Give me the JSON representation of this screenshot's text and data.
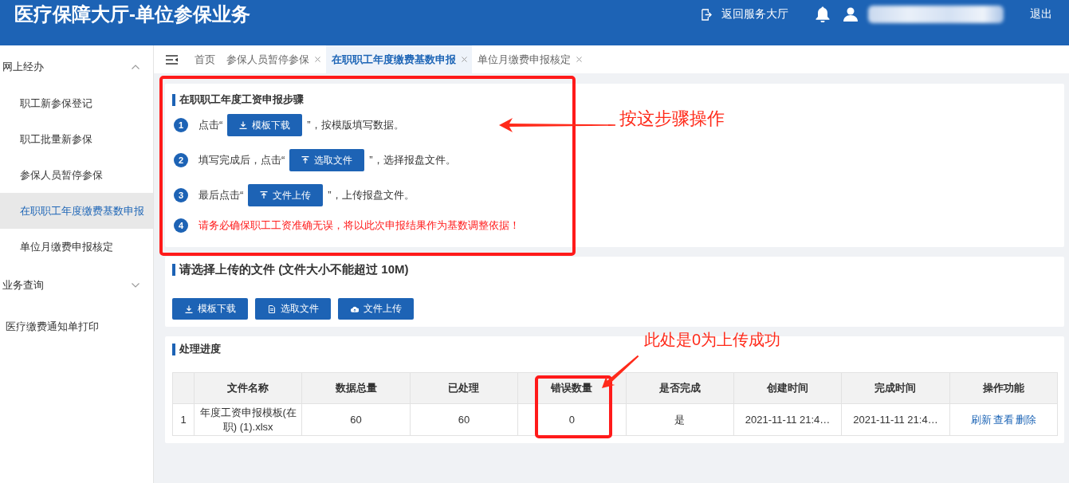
{
  "header": {
    "title": "医疗保障大厅-单位参保业务",
    "back_link": "返回服务大厅",
    "user_name_blurred": true,
    "logout": "退出"
  },
  "sidebar": {
    "items": [
      {
        "kind": "group",
        "label": "网上经办",
        "expanded": true,
        "children": [
          {
            "label": "职工新参保登记",
            "selected": false
          },
          {
            "label": "职工批量新参保",
            "selected": false
          },
          {
            "label": "参保人员暂停参保",
            "selected": false
          },
          {
            "label": "在职职工年度缴费基数申报",
            "selected": true
          },
          {
            "label": "单位月缴费申报核定",
            "selected": false
          }
        ]
      },
      {
        "kind": "group",
        "label": "业务查询",
        "expanded": false
      },
      {
        "kind": "link",
        "label": "医疗缴费通知单打印",
        "selected": false
      }
    ]
  },
  "tabs": [
    {
      "label": "首页",
      "closable": false,
      "selected": false
    },
    {
      "label": "参保人员暂停参保",
      "closable": true,
      "selected": false
    },
    {
      "label": "在职职工年度缴费基数申报",
      "closable": true,
      "selected": true
    },
    {
      "label": "单位月缴费申报核定",
      "closable": true,
      "selected": false
    }
  ],
  "steps_panel": {
    "title": "在职职工年度工资申报步骤",
    "steps": [
      {
        "number": "1",
        "kind": "button",
        "before": "点击“",
        "button": {
          "label": "模板下载",
          "kind": "download"
        },
        "after": "”，按模版填写数据。"
      },
      {
        "number": "2",
        "kind": "button",
        "before": "填写完成后，点击“",
        "button": {
          "label": "选取文件",
          "kind": "upload"
        },
        "after": "”，选择报盘文件。"
      },
      {
        "number": "3",
        "kind": "button",
        "before": "最后点击“",
        "button": {
          "label": "文件上传",
          "kind": "upload"
        },
        "after": "”，上传报盘文件。"
      },
      {
        "number": "4",
        "kind": "notice",
        "text": "请务必确保职工工资准确无误，将以此次申报结果作为基数调整依据！"
      }
    ]
  },
  "upload_panel": {
    "title": "请选择上传的文件 (文件大小不能超过 10M)",
    "buttons": [
      {
        "label": "模板下载",
        "kind": "download"
      },
      {
        "label": "选取文件",
        "kind": "document"
      },
      {
        "label": "文件上传",
        "kind": "cloud"
      }
    ]
  },
  "progress_panel": {
    "title": "处理进度",
    "table": {
      "columns": [
        "文件名称",
        "数据总量",
        "已处理",
        "错误数量",
        "是否完成",
        "创建时间",
        "完成时间",
        "操作功能"
      ],
      "rows": [
        {
          "index": "1",
          "cells": [
            "年度工资申报模板(在职) (1).xlsx",
            "60",
            "60",
            "0",
            "是",
            "2021-11-11 21:4…",
            "2021-11-11 21:4…"
          ],
          "actions": [
            "刷新",
            "查看",
            "删除"
          ]
        }
      ]
    }
  },
  "annotations": [
    {
      "text": "按这步骤操作",
      "framed": true
    },
    {
      "text": "此处是0为上传成功",
      "framed": true
    }
  ]
}
